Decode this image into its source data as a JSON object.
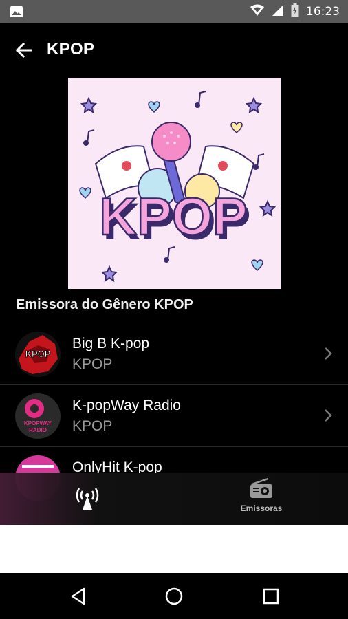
{
  "status_bar": {
    "time": "16:23"
  },
  "app_bar": {
    "title": "KPOP"
  },
  "cover": {
    "text": "KPOP"
  },
  "section_title": "Emissora do Gênero KPOP",
  "stations": [
    {
      "name": "Big B K-pop",
      "genre": "KPOP",
      "logo_text": "KPOP"
    },
    {
      "name": "K-popWay Radio",
      "genre": "KPOP",
      "logo_text": "KPOPWAY RADIO"
    },
    {
      "name": "OnlyHit K-pop",
      "genre": ""
    }
  ],
  "bottom_nav": {
    "stations_label": "Emissoras"
  },
  "colors": {
    "accent": "#e04aa8",
    "cover_bg": "#fbe8f6"
  }
}
